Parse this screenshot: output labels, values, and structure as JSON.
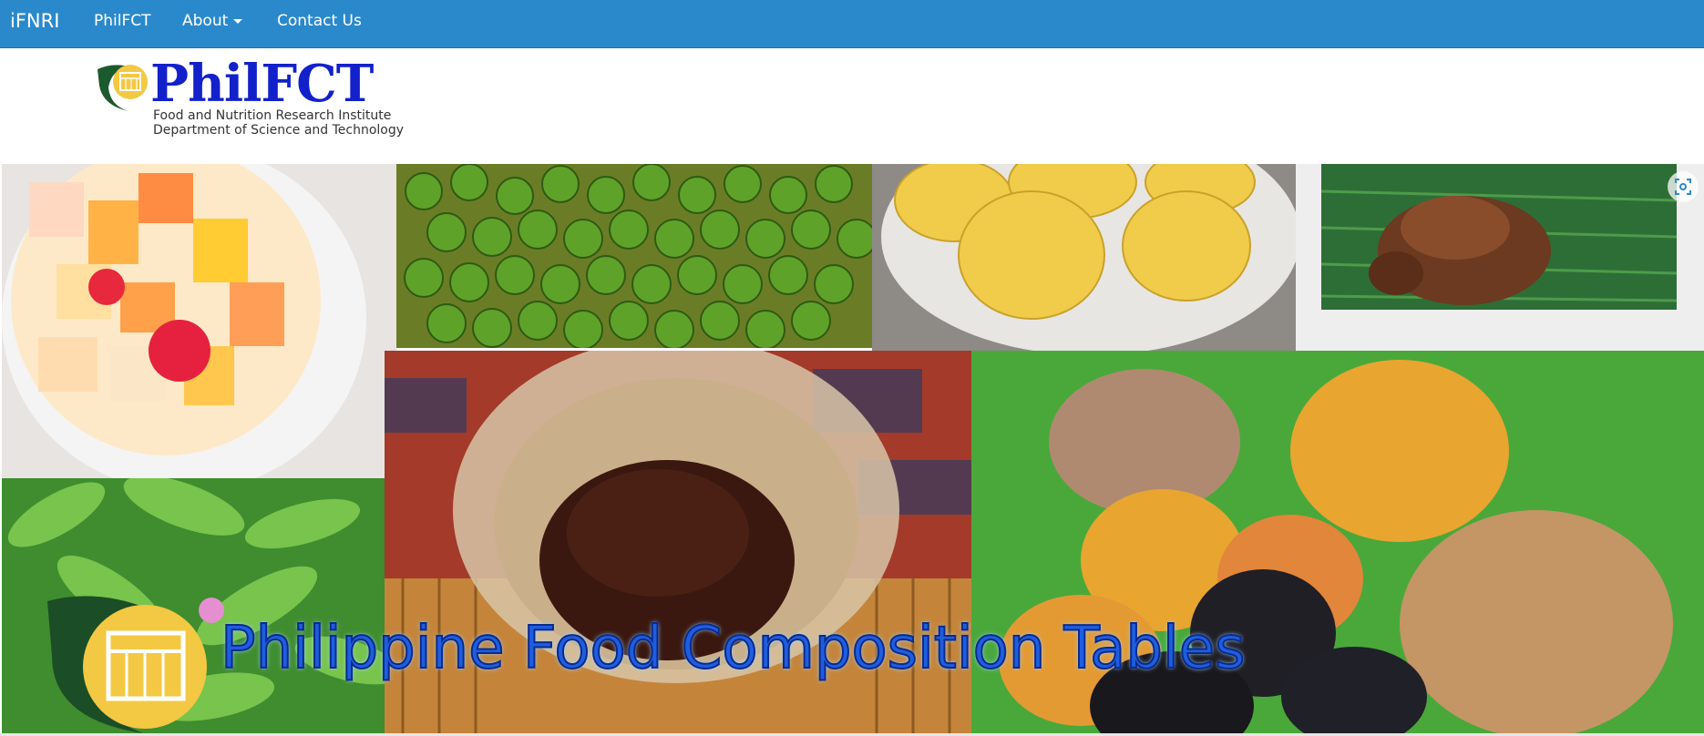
{
  "navbar": {
    "brand": "iFNRI",
    "links": [
      {
        "label": "PhilFCT"
      },
      {
        "label": "About"
      },
      {
        "label": "Contact Us"
      }
    ],
    "color": "#2a89cb"
  },
  "logo": {
    "title": "PhilFCT",
    "line1": "Food and Nutrition Research Institute",
    "line2": "Department of Science and Technology"
  },
  "banner": {
    "title": "Philippine Food Composition Tables"
  },
  "icons": [
    "calendar-logo-icon",
    "fullscreen-icon",
    "caret-down-icon"
  ]
}
